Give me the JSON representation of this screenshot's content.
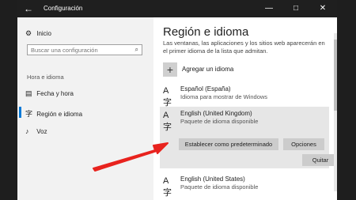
{
  "titlebar": {
    "back_icon": "←",
    "title": "Configuración",
    "minimize": "—",
    "maximize": "□",
    "close": "✕"
  },
  "sidebar": {
    "home": {
      "icon": "gear-icon",
      "label": "Inicio"
    },
    "search": {
      "placeholder": "Buscar una configuración"
    },
    "section": "Hora e idioma",
    "items": [
      {
        "icon": "calendar-icon",
        "label": "Fecha y hora"
      },
      {
        "icon": "language-icon",
        "label": "Región e idioma"
      },
      {
        "icon": "microphone-icon",
        "label": "Voz"
      }
    ]
  },
  "main": {
    "heading": "Región e idioma",
    "description": "Las ventanas, las aplicaciones y los sitios web aparecerán en el primer idioma de la lista que admitan.",
    "add_language": "Agregar un idioma",
    "languages": [
      {
        "name": "Español (España)",
        "sub": "Idioma para mostrar de Windows"
      },
      {
        "name": "English (United Kingdom)",
        "sub": "Paquete de idioma disponible"
      },
      {
        "name": "English (United States)",
        "sub": "Paquete de idioma disponible"
      }
    ],
    "buttons": {
      "set_default": "Establecer como predeterminado",
      "options": "Opciones",
      "remove": "Quitar"
    }
  },
  "colors": {
    "accent": "#0078d7",
    "arrow": "#e8231e",
    "titlebar": "#1f1f1f"
  }
}
